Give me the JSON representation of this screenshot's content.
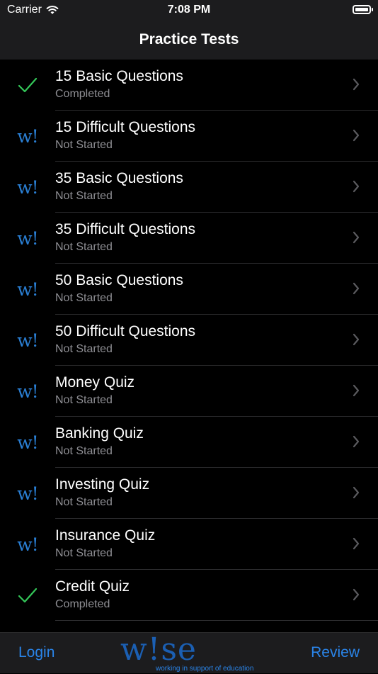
{
  "status": {
    "carrier": "Carrier",
    "time": "7:08 PM"
  },
  "nav": {
    "title": "Practice Tests"
  },
  "tests": [
    {
      "title": "15 Basic Questions",
      "status": "Completed",
      "icon": "checkmark-icon"
    },
    {
      "title": "15 Difficult Questions",
      "status": "Not Started",
      "icon": "wise-logo-icon"
    },
    {
      "title": "35 Basic Questions",
      "status": "Not Started",
      "icon": "wise-logo-icon"
    },
    {
      "title": "35 Difficult Questions",
      "status": "Not Started",
      "icon": "wise-logo-icon"
    },
    {
      "title": "50 Basic Questions",
      "status": "Not Started",
      "icon": "wise-logo-icon"
    },
    {
      "title": "50 Difficult Questions",
      "status": "Not Started",
      "icon": "wise-logo-icon"
    },
    {
      "title": "Money Quiz",
      "status": "Not Started",
      "icon": "wise-logo-icon"
    },
    {
      "title": "Banking Quiz",
      "status": "Not Started",
      "icon": "wise-logo-icon"
    },
    {
      "title": "Investing Quiz",
      "status": "Not Started",
      "icon": "wise-logo-icon"
    },
    {
      "title": "Insurance Quiz",
      "status": "Not Started",
      "icon": "wise-logo-icon"
    },
    {
      "title": "Credit Quiz",
      "status": "Completed",
      "icon": "checkmark-icon"
    }
  ],
  "icon_text": {
    "w": "w!"
  },
  "tab_bar": {
    "login_label": "Login",
    "review_label": "Review",
    "logo_word": "w!se",
    "logo_tagline": "working in support of education"
  },
  "colors": {
    "accent": "#2a84e8",
    "check": "#34c759",
    "secondary_text": "#8e8e93"
  }
}
